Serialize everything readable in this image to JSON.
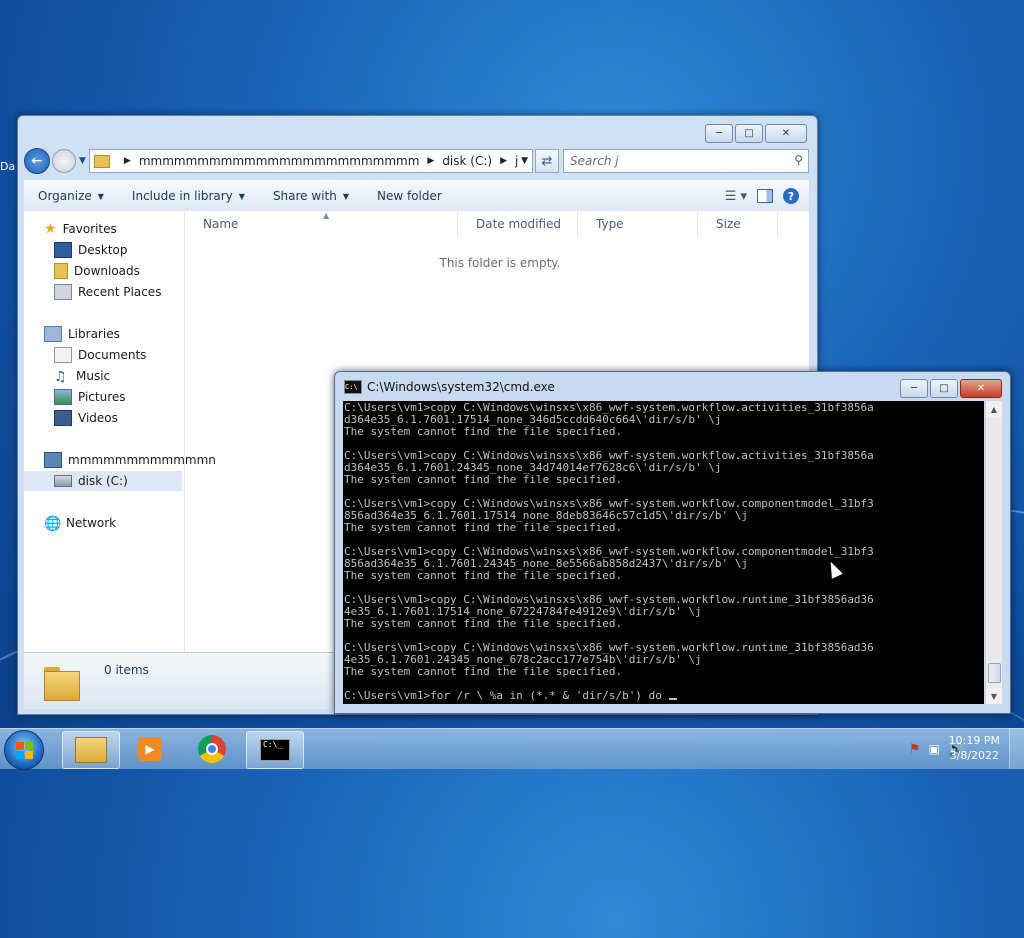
{
  "desktop": {
    "partial_label": "Da"
  },
  "explorer": {
    "address": {
      "segments": [
        "mmmmmmmmmmmmmmmmmmmmmmmm",
        "disk (C:)",
        "j"
      ]
    },
    "search_placeholder": "Search j",
    "toolbar": {
      "organize": "Organize",
      "include_in_library": "Include in library",
      "share_with": "Share with",
      "new_folder": "New folder"
    },
    "nav": {
      "favorites": "Favorites",
      "desktop": "Desktop",
      "downloads": "Downloads",
      "recent_places": "Recent Places",
      "libraries": "Libraries",
      "documents": "Documents",
      "music": "Music",
      "pictures": "Pictures",
      "videos": "Videos",
      "computer": "mmmmmmmmmmmmn",
      "disk_c": "disk (C:)",
      "network": "Network"
    },
    "columns": [
      "Name",
      "Date modified",
      "Type",
      "Size"
    ],
    "empty_message": "This folder is empty.",
    "items_count": "0 items"
  },
  "cmd": {
    "title": "C:\\Windows\\system32\\cmd.exe",
    "output": "C:\\Users\\vm1>copy C:\\Windows\\winsxs\\x86_wwf-system.workflow.activities_31bf3856a\nd364e35_6.1.7601.17514_none_346d5ccdd640c664\\'dir/s/b' \\j\nThe system cannot find the file specified.\n\nC:\\Users\\vm1>copy C:\\Windows\\winsxs\\x86_wwf-system.workflow.activities_31bf3856a\nd364e35_6.1.7601.24345_none_34d74014ef7628c6\\'dir/s/b' \\j\nThe system cannot find the file specified.\n\nC:\\Users\\vm1>copy C:\\Windows\\winsxs\\x86_wwf-system.workflow.componentmodel_31bf3\n856ad364e35_6.1.7601.17514_none_8deb83646c57c1d5\\'dir/s/b' \\j\nThe system cannot find the file specified.\n\nC:\\Users\\vm1>copy C:\\Windows\\winsxs\\x86_wwf-system.workflow.componentmodel_31bf3\n856ad364e35_6.1.7601.24345_none_8e5566ab858d2437\\'dir/s/b' \\j\nThe system cannot find the file specified.\n\nC:\\Users\\vm1>copy C:\\Windows\\winsxs\\x86_wwf-system.workflow.runtime_31bf3856ad36\n4e35_6.1.7601.17514_none_67224784fe4912e9\\'dir/s/b' \\j\nThe system cannot find the file specified.\n\nC:\\Users\\vm1>copy C:\\Windows\\winsxs\\x86_wwf-system.workflow.runtime_31bf3856ad36\n4e35_6.1.7601.24345_none_678c2acc177e754b\\'dir/s/b' \\j\nThe system cannot find the file specified.\n\n",
    "prompt_line": "C:\\Users\\vm1>for /r \\ %a in (*.* & 'dir/s/b') do "
  },
  "taskbar": {
    "time": "10:19 PM",
    "date": "3/8/2022",
    "console_button_label": "C:\\_"
  }
}
